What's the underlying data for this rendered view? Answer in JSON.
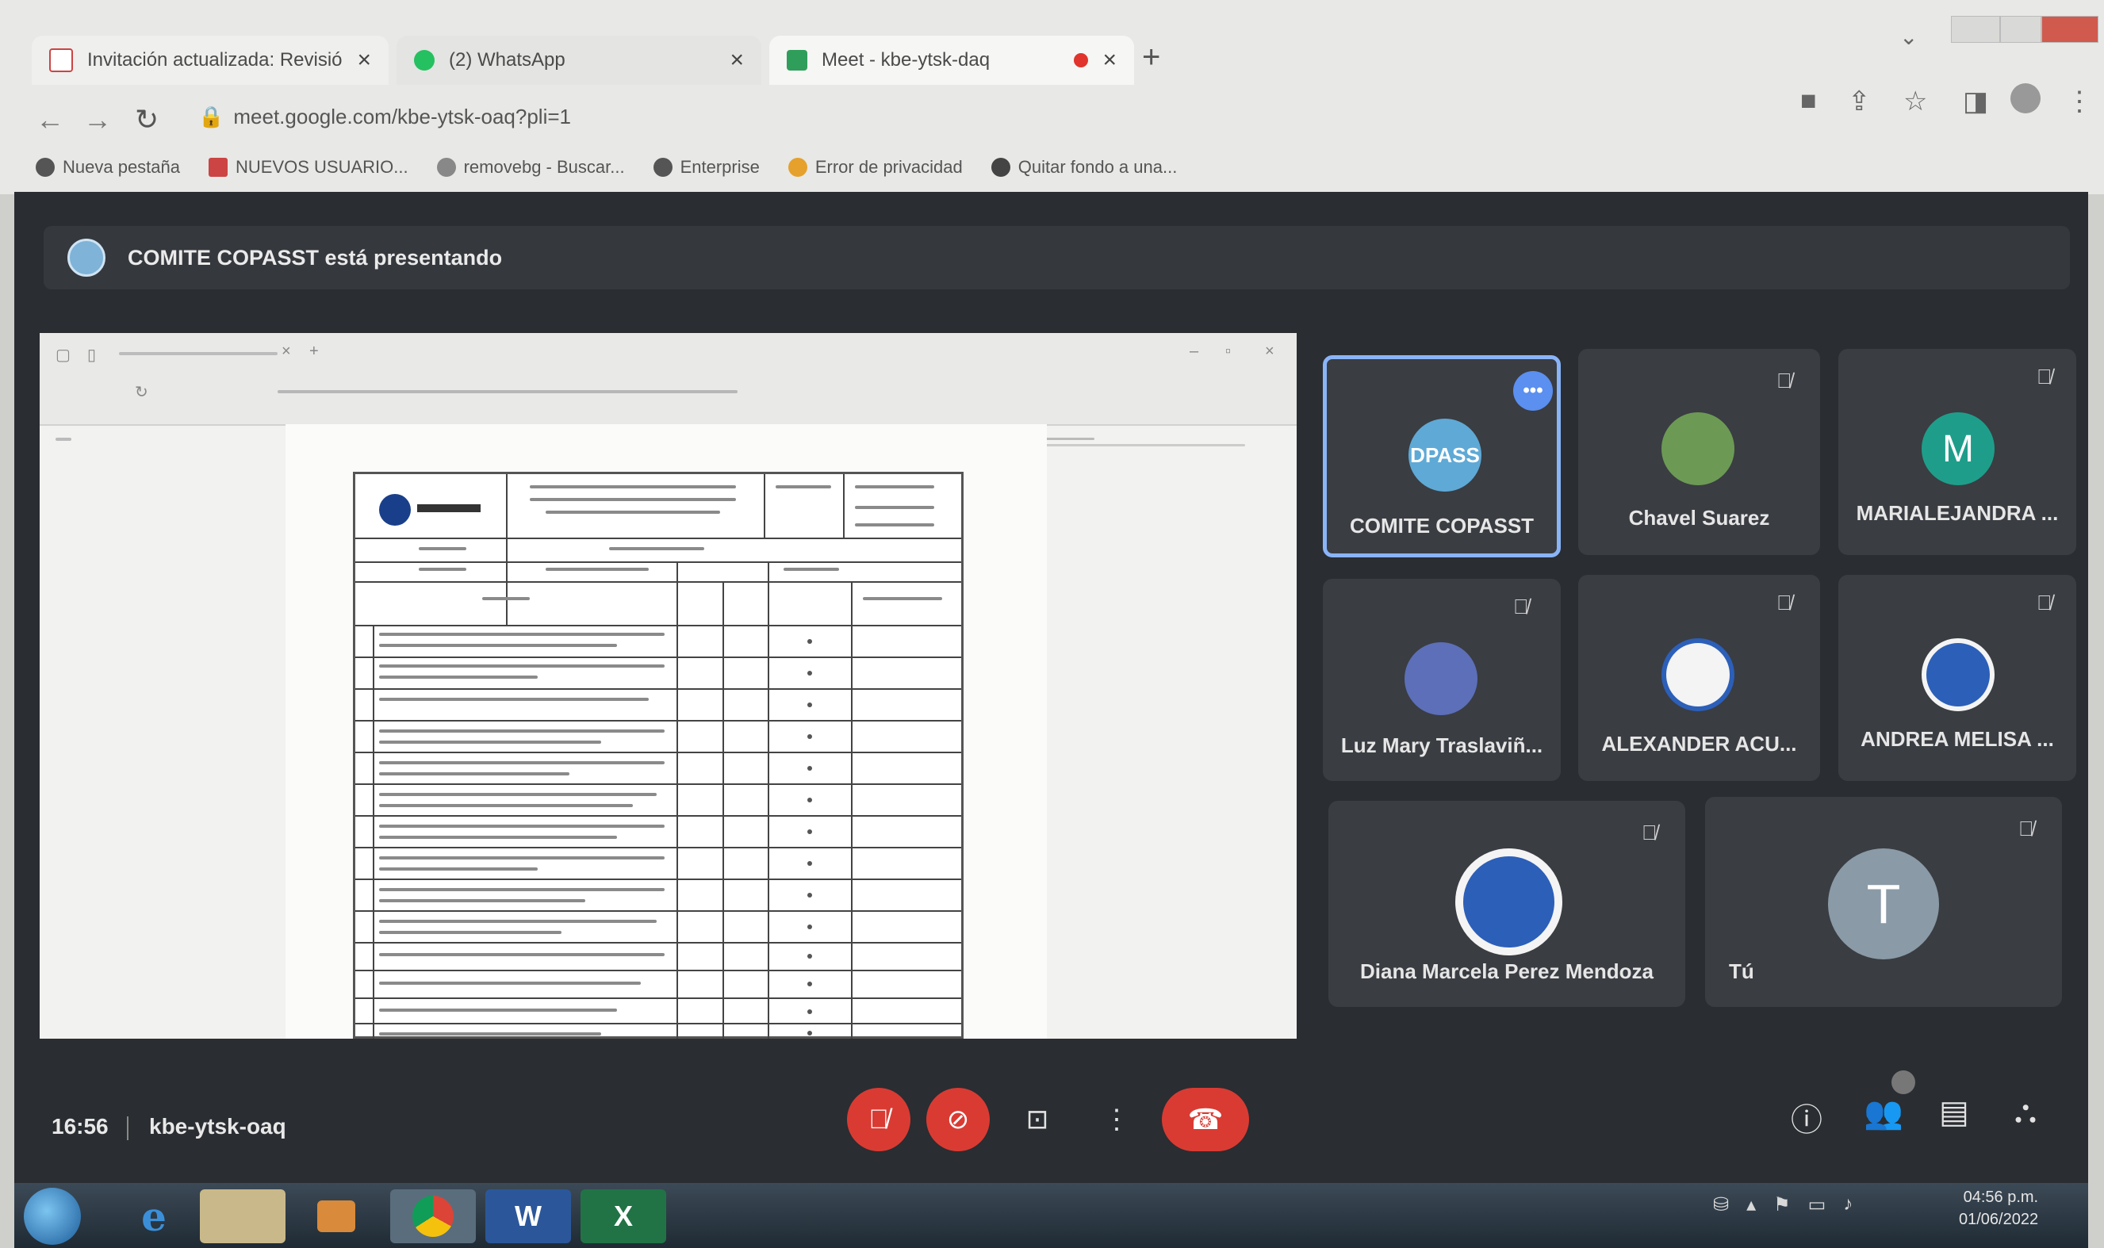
{
  "browser": {
    "tabs": [
      {
        "label": "Invitación actualizada: Revisión",
        "favicon": "gmail-icon"
      },
      {
        "label": "(2) WhatsApp",
        "favicon": "whatsapp-icon"
      },
      {
        "label": "Meet - kbe-ytsk-daq",
        "favicon": "meet-icon"
      }
    ],
    "url": "meet.google.com/kbe-ytsk-oaq?pli=1",
    "bookmarks": [
      "Nueva pestaña",
      "NUEVOS USUARIO...",
      "removebg - Buscar...",
      "Enterprise",
      "Error de privacidad",
      "Quitar fondo a una..."
    ]
  },
  "meet": {
    "presenting_text": "COMITE COPASST está presentando",
    "time": "16:56",
    "meeting_code": "kbe-ytsk-oaq",
    "participants": [
      {
        "name": "COMITE COPASST",
        "avatar_text": "DPASS"
      },
      {
        "name": "Chavel Suarez"
      },
      {
        "name": "MARIALEJANDRA ...",
        "avatar_text": "M"
      },
      {
        "name": "Luz Mary Traslaviñ..."
      },
      {
        "name": "ALEXANDER ACU..."
      },
      {
        "name": "ANDREA MELISA ..."
      },
      {
        "name": "Diana Marcela Perez Mendoza"
      },
      {
        "name": "Tú",
        "avatar_text": "T"
      }
    ]
  },
  "taskbar": {
    "clock_time": "04:56 p.m.",
    "clock_date": "01/06/2022"
  },
  "colors": {
    "meet_bg": "#2a2d31",
    "tile_bg": "#3a3d42",
    "active_border": "#8ab4f8",
    "end_call_red": "#d93b33",
    "avatar_m": "#1e9e8a",
    "avatar_t": "#8a9aa6"
  }
}
